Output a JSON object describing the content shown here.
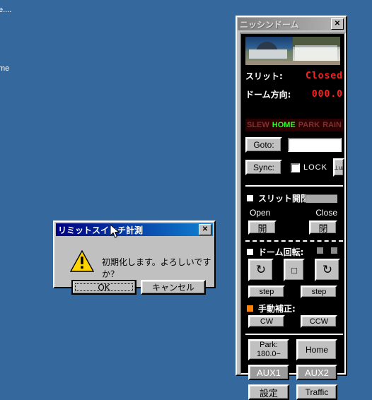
{
  "desktop": {
    "background_color": "#35689c",
    "icon_labels": [
      {
        "text": "e....",
        "note": "clipped at left screen edge"
      },
      {
        "text": "me",
        "note": "clipped at left screen edge"
      }
    ]
  },
  "dome_window": {
    "title": "ニッシンドーム",
    "active": false,
    "close_button": "✕",
    "photos": [
      {
        "name": "observatory-dome-photo"
      },
      {
        "name": "observatory-building-photo"
      }
    ],
    "status": [
      {
        "label": "スリット:",
        "value": "Closed",
        "color": "#ff2020"
      },
      {
        "label": "ドーム方向:",
        "value": "000.0",
        "color": "#ff2020"
      }
    ],
    "mode_bar": {
      "items": [
        {
          "label": "SLEW",
          "active": false
        },
        {
          "label": "HOME",
          "active": true
        },
        {
          "label": "PARK",
          "active": false
        },
        {
          "label": "RAIN",
          "active": false
        }
      ],
      "active_color": "#22ff22",
      "inactive_color": "#803030",
      "background": "#2b0000"
    },
    "goto": {
      "button_label": "Goto:",
      "input_value": "",
      "input_placeholder": ""
    },
    "sync": {
      "button_label": "Sync:",
      "lock_label": "LOCK",
      "lock_checked": false,
      "mini_button_label": "⊥ɯ"
    },
    "slit_section": {
      "title": "スリット開閉:",
      "indicator_color": "#a8a8a8",
      "open_label": "Open",
      "close_label": "Close",
      "open_button": "開",
      "close_button": "閉"
    },
    "rotation_section": {
      "title": "ドーム回転:",
      "indicators": [
        "#8a8a8a",
        "#8a8a8a"
      ],
      "ccw_button": "↻",
      "stop_button": "□",
      "cw_button": "↻",
      "step_left": "step",
      "step_right": "step"
    },
    "manual_section": {
      "title": "手動補正:",
      "indicator_color": "#ff8000",
      "cw_button": "CW",
      "ccw_button": "CCW"
    },
    "bottom_buttons": {
      "park_line1": "Park:",
      "park_line2": "180.0−",
      "home": "Home",
      "aux1": "AUX1",
      "aux2": "AUX2",
      "settings": "設定",
      "traffic": "Traffic"
    }
  },
  "message_dialog": {
    "title": "リミットスイッチ計測",
    "close_button": "✕",
    "icon": "warning-triangle",
    "message": "初期化します。よろしいですか？",
    "ok_button": "OK",
    "cancel_button": "キャンセル"
  }
}
